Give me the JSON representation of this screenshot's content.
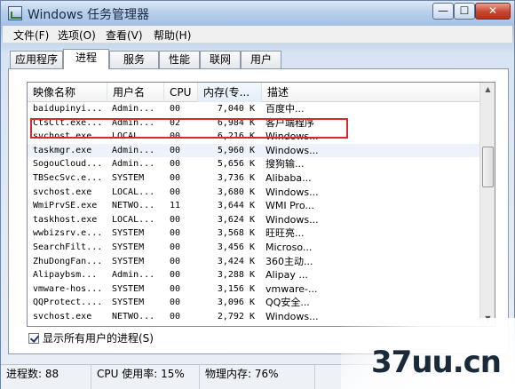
{
  "window": {
    "title": "Windows 任务管理器",
    "minimize": "—",
    "maximize": "☐",
    "close": "✕"
  },
  "menu": [
    "文件(F)",
    "选项(O)",
    "查看(V)",
    "帮助(H)"
  ],
  "tabs": [
    "应用程序",
    "进程",
    "服务",
    "性能",
    "联网",
    "用户"
  ],
  "active_tab": "进程",
  "columns": [
    "映像名称",
    "用户名",
    "CPU",
    "内存(专...",
    "描述"
  ],
  "rows": [
    {
      "name": "baidupinyi...",
      "user": "Admin...",
      "cpu": "00",
      "mem": "7,040 K",
      "desc": "百度中..."
    },
    {
      "name": "CtsClt.exe...",
      "user": "Admin...",
      "cpu": "02",
      "mem": "6,984 K",
      "desc": "客户端程序"
    },
    {
      "name": "svchost.exe",
      "user": "LOCAL...",
      "cpu": "00",
      "mem": "6,216 K",
      "desc": "Windows..."
    },
    {
      "name": "taskmgr.exe",
      "user": "Admin...",
      "cpu": "00",
      "mem": "5,960 K",
      "desc": "Windows..."
    },
    {
      "name": "SogouCloud...",
      "user": "Admin...",
      "cpu": "00",
      "mem": "5,656 K",
      "desc": "搜狗输..."
    },
    {
      "name": "TBSecSvc.e...",
      "user": "SYSTEM",
      "cpu": "00",
      "mem": "3,736 K",
      "desc": "Alibaba..."
    },
    {
      "name": "svchost.exe",
      "user": "LOCAL...",
      "cpu": "00",
      "mem": "3,680 K",
      "desc": "Windows..."
    },
    {
      "name": "WmiPrvSE.exe",
      "user": "NETWO...",
      "cpu": "11",
      "mem": "3,644 K",
      "desc": "WMI Pro..."
    },
    {
      "name": "taskhost.exe",
      "user": "LOCAL...",
      "cpu": "00",
      "mem": "3,624 K",
      "desc": "Windows..."
    },
    {
      "name": "wwbizsrv.e...",
      "user": "SYSTEM",
      "cpu": "00",
      "mem": "3,568 K",
      "desc": "旺旺亮..."
    },
    {
      "name": "SearchFilt...",
      "user": "SYSTEM",
      "cpu": "00",
      "mem": "3,456 K",
      "desc": "Microso..."
    },
    {
      "name": "ZhuDongFan...",
      "user": "SYSTEM",
      "cpu": "00",
      "mem": "3,424 K",
      "desc": "360主动..."
    },
    {
      "name": "Alipaybsm...",
      "user": "Admin...",
      "cpu": "00",
      "mem": "3,288 K",
      "desc": "Alipay ..."
    },
    {
      "name": "vmware-hos...",
      "user": "SYSTEM",
      "cpu": "00",
      "mem": "3,156 K",
      "desc": "vmware-..."
    },
    {
      "name": "QQProtect....",
      "user": "SYSTEM",
      "cpu": "00",
      "mem": "3,096 K",
      "desc": "QQ安全..."
    },
    {
      "name": "svchost.exe",
      "user": "NETWO...",
      "cpu": "00",
      "mem": "2,792 K",
      "desc": "Windows..."
    }
  ],
  "show_all_users": "显示所有用户的进程(S)",
  "status": {
    "processes": "进程数: 88",
    "cpu": "CPU 使用率: 15%",
    "memory": "物理内存: 76%"
  },
  "watermark": "37uu.cn",
  "colors": {
    "highlight_box": "#d12b2b",
    "close_button": "#c8452d"
  }
}
